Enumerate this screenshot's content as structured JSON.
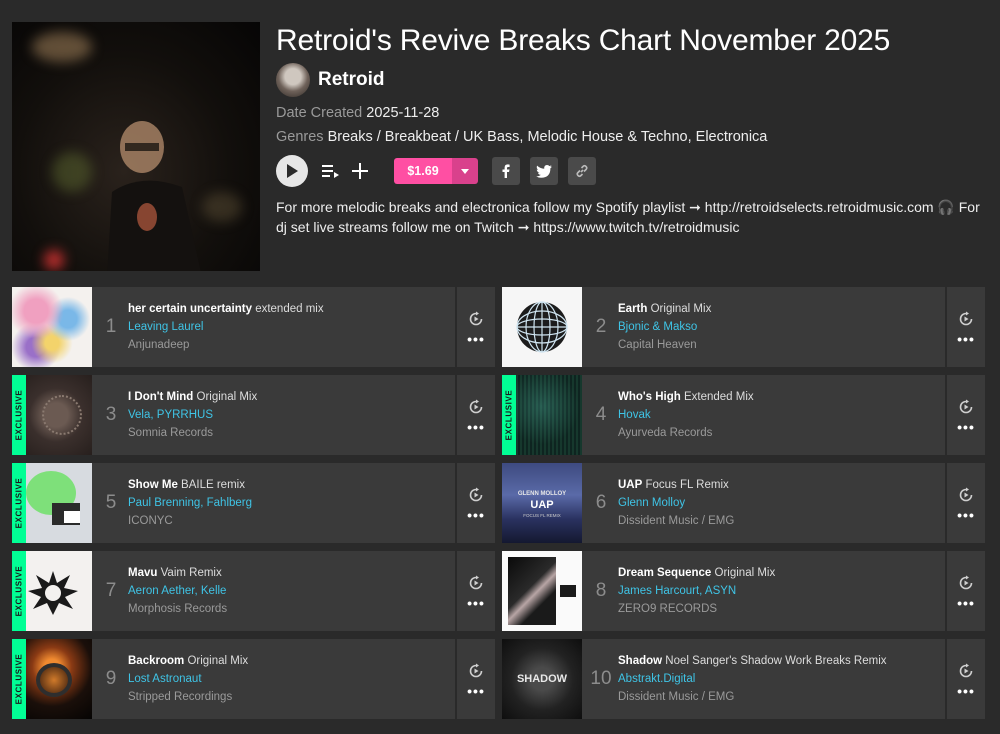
{
  "chart": {
    "title": "Retroid's Revive Breaks Chart November 2025",
    "artist": "Retroid",
    "date_label": "Date Created",
    "date_value": "2025-11-28",
    "genres_label": "Genres",
    "genres_value": "Breaks / Breakbeat / UK Bass, Melodic House & Techno, Electronica",
    "price": "$1.69",
    "description": "For more melodic breaks and electronica follow my Spotify playlist ➞ http://retroidselects.retroidmusic.com 🎧 For dj set live streams follow me on Twitch ➞ https://www.twitch.tv/retroidmusic"
  },
  "icons": {
    "play": "play-icon",
    "queue": "add-to-queue-icon",
    "add": "plus-icon",
    "dropdown": "chevron-down-icon",
    "facebook": "facebook-icon",
    "twitter": "twitter-icon",
    "link": "link-icon",
    "track_play": "play-circle-icon",
    "more": "more-dots-icon"
  },
  "colors": {
    "background": "#2a2a2a",
    "row": "#3a3a3a",
    "accent_pink": "#ff4fa3",
    "artist_blue": "#3fc4e6",
    "exclusive_green": "#01ff95"
  },
  "exclusive_label": "EXCLUSIVE",
  "more_label": "•••",
  "tracks": [
    {
      "num": "1",
      "name": "her certain uncertainty",
      "mix": "extended mix",
      "artists": "Leaving Laurel",
      "label": "Anjunadeep",
      "exclusive": false
    },
    {
      "num": "2",
      "name": "Earth",
      "mix": "Original Mix",
      "artists": "Bjonic & Makso",
      "label": "Capital Heaven",
      "exclusive": false
    },
    {
      "num": "3",
      "name": "I Don't Mind",
      "mix": "Original Mix",
      "artists": "Vela, PYRRHUS",
      "label": "Somnia Records",
      "exclusive": true
    },
    {
      "num": "4",
      "name": "Who's High",
      "mix": "Extended Mix",
      "artists": "Hovak",
      "label": "Ayurveda Records",
      "exclusive": true
    },
    {
      "num": "5",
      "name": "Show Me",
      "mix": "BAILE remix",
      "artists": "Paul Brenning, Fahlberg",
      "label": "ICONYC",
      "exclusive": true
    },
    {
      "num": "6",
      "name": "UAP",
      "mix": "Focus FL Remix",
      "artists": "Glenn Molloy",
      "label": "Dissident Music / EMG",
      "exclusive": false,
      "art_text_1": "GLENN MOLLOY",
      "art_text_2": "UAP",
      "art_text_3": "FOCUS FL REMIX"
    },
    {
      "num": "7",
      "name": "Mavu",
      "mix": "Vaim Remix",
      "artists": "Aeron Aether, Kelle",
      "label": "Morphosis Records",
      "exclusive": true
    },
    {
      "num": "8",
      "name": "Dream Sequence",
      "mix": "Original Mix",
      "artists": "James Harcourt, ASYN",
      "label": "ZERO9 RECORDS",
      "exclusive": false
    },
    {
      "num": "9",
      "name": "Backroom",
      "mix": "Original Mix",
      "artists": "Lost Astronaut",
      "label": "Stripped Recordings",
      "exclusive": true
    },
    {
      "num": "10",
      "name": "Shadow",
      "mix": "Noel Sanger's Shadow Work Breaks Remix",
      "artists": "Abstrakt.Digital",
      "label": "Dissident Music / EMG",
      "exclusive": false,
      "art_text_1": "SHADOW"
    }
  ]
}
